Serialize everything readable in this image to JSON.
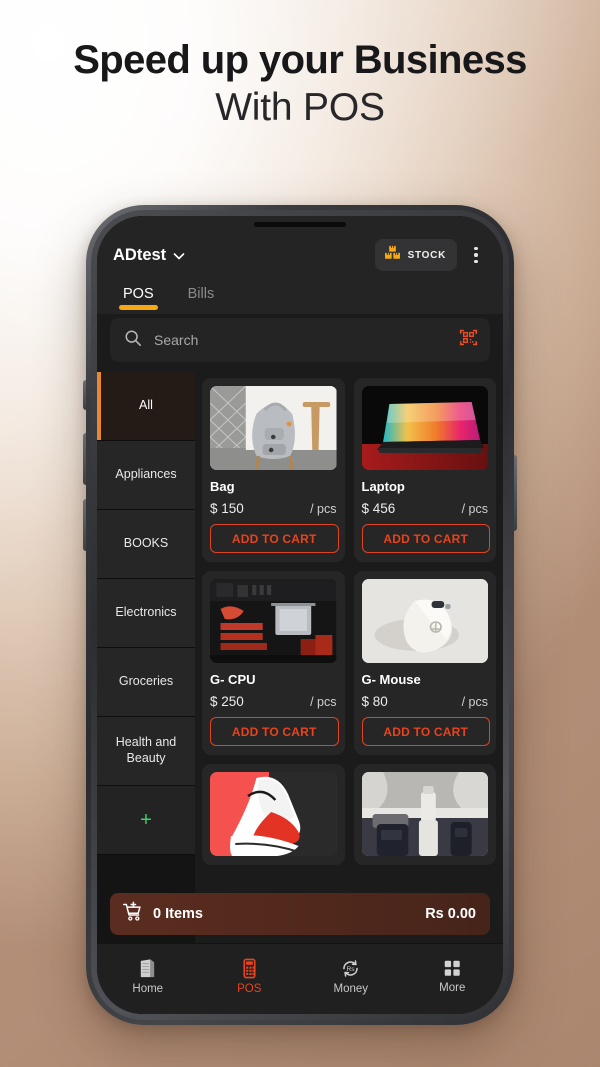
{
  "promo": {
    "line1": "Speed up your Business",
    "line2": "With POS"
  },
  "colors": {
    "accent_orange": "#f6a714",
    "accent_red": "#e8431c",
    "add_green": "#3dcf6a",
    "cat_selected_bg": "#241a16",
    "screen_bg": "#1b1b1b",
    "card_bg": "#262626",
    "bg_gradient_start": "#ffffff",
    "bg_gradient_end": "#b4907a"
  },
  "appbar": {
    "business_name": "ADtest",
    "chevron_icon": "chevron-down-icon",
    "stock_label": "STOCK",
    "stock_icon": "boxes-stack-icon",
    "menu_icon": "kebab-menu-icon",
    "tabs": [
      {
        "label": "POS",
        "active": true
      },
      {
        "label": "Bills",
        "active": false
      }
    ]
  },
  "search": {
    "placeholder": "Search",
    "value": "",
    "search_icon": "search-icon",
    "scan_icon": "qr-scan-icon"
  },
  "categories": [
    {
      "label": "All",
      "selected": true
    },
    {
      "label": "Appliances",
      "selected": false
    },
    {
      "label": "BOOKS",
      "selected": false
    },
    {
      "label": "Electronics",
      "selected": false
    },
    {
      "label": "Groceries",
      "selected": false
    },
    {
      "label": "Health and Beauty",
      "selected": false
    }
  ],
  "add_category": {
    "label": "+",
    "icon": "plus-icon"
  },
  "products": [
    {
      "name": "Bag",
      "price": "$ 150",
      "unit": "/ pcs",
      "action": "ADD TO CART",
      "image": "grey-backpack-photo"
    },
    {
      "name": "Laptop",
      "price": "$ 456",
      "unit": "/ pcs",
      "action": "ADD TO CART",
      "image": "open-laptop-photo"
    },
    {
      "name": "G- CPU",
      "price": "$ 250",
      "unit": "/ pcs",
      "action": "ADD TO CART",
      "image": "cpu-motherboard-photo"
    },
    {
      "name": "G- Mouse",
      "price": "$ 80",
      "unit": "/ pcs",
      "action": "ADD TO CART",
      "image": "white-mouse-photo"
    },
    {
      "name": "",
      "price": "",
      "unit": "",
      "action": "",
      "image": "red-white-sneaker-photo"
    },
    {
      "name": "",
      "price": "",
      "unit": "",
      "action": "",
      "image": "cosmetics-tubes-photo"
    }
  ],
  "cart": {
    "icon": "cart-plus-icon",
    "items_text": "0 Items",
    "total_text": "Rs 0.00"
  },
  "bottom_nav": [
    {
      "label": "Home",
      "icon": "building-icon",
      "active": false
    },
    {
      "label": "POS",
      "icon": "pos-terminal-icon",
      "active": true
    },
    {
      "label": "Money",
      "icon": "rupee-refresh-icon",
      "active": false
    },
    {
      "label": "More",
      "icon": "grid-squares-icon",
      "active": false
    }
  ]
}
